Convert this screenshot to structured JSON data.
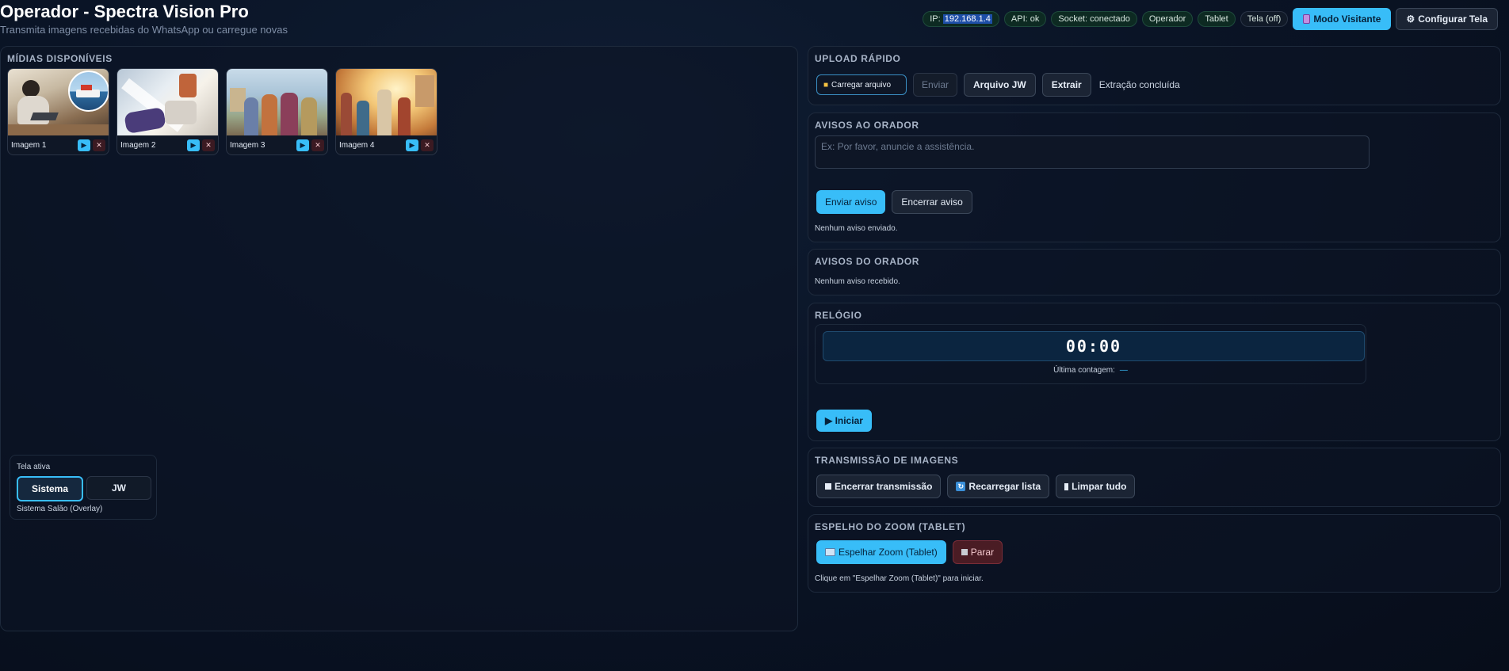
{
  "header": {
    "title": "Operador - Spectra Vision Pro",
    "subtitle": "Transmita imagens recebidas do WhatsApp ou carregue novas",
    "status": {
      "ip_label": "IP:",
      "ip_value": "192.168.1.4",
      "api": "API: ok",
      "socket": "Socket: conectado",
      "role": "Operador",
      "device": "Tablet",
      "screen": "Tela (off)"
    },
    "visitor_button": "Modo Visitante",
    "visitor_icon": "phone-icon",
    "config_button": "Configurar Tela",
    "config_icon": "gear-icon"
  },
  "media": {
    "title": "MÍDIAS DISPONÍVEIS",
    "items": [
      {
        "label": "Imagem 1"
      },
      {
        "label": "Imagem 2"
      },
      {
        "label": "Imagem 3"
      },
      {
        "label": "Imagem 4"
      }
    ]
  },
  "active_screen": {
    "label": "Tela ativa",
    "options": [
      "Sistema",
      "JW"
    ],
    "selected": "Sistema",
    "description": "Sistema Salão (Overlay)"
  },
  "upload": {
    "title": "UPLOAD RÁPIDO",
    "file_button": "Carregar arquivo",
    "file_icon": "folder-icon",
    "send": "Enviar",
    "jw_file": "Arquivo JW",
    "extract": "Extrair",
    "status": "Extração concluída"
  },
  "speaker_notices": {
    "title": "AVISOS AO ORADOR",
    "placeholder": "Ex: Por favor, anuncie a assistência.",
    "send": "Enviar aviso",
    "end": "Encerrar aviso",
    "status": "Nenhum aviso enviado."
  },
  "speaker_received": {
    "title": "AVISOS DO ORADOR",
    "status": "Nenhum aviso recebido."
  },
  "clock": {
    "title": "RELÓGIO",
    "time": "00:00",
    "last_label": "Última contagem:",
    "last_value": "—",
    "start": "▶ Iniciar"
  },
  "transmission": {
    "title": "TRANSMISSÃO DE IMAGENS",
    "end": "Encerrar transmissão",
    "reload": "Recarregar lista",
    "clear": "Limpar tudo"
  },
  "zoom_mirror": {
    "title": "ESPELHO DO ZOOM (TABLET)",
    "mirror": "Espelhar Zoom (Tablet)",
    "stop": "Parar",
    "hint": "Clique em \"Espelhar Zoom (Tablet)\" para iniciar."
  },
  "colors": {
    "accent": "#38bdf8",
    "background": "#0a1426",
    "danger": "#4a1c24"
  }
}
